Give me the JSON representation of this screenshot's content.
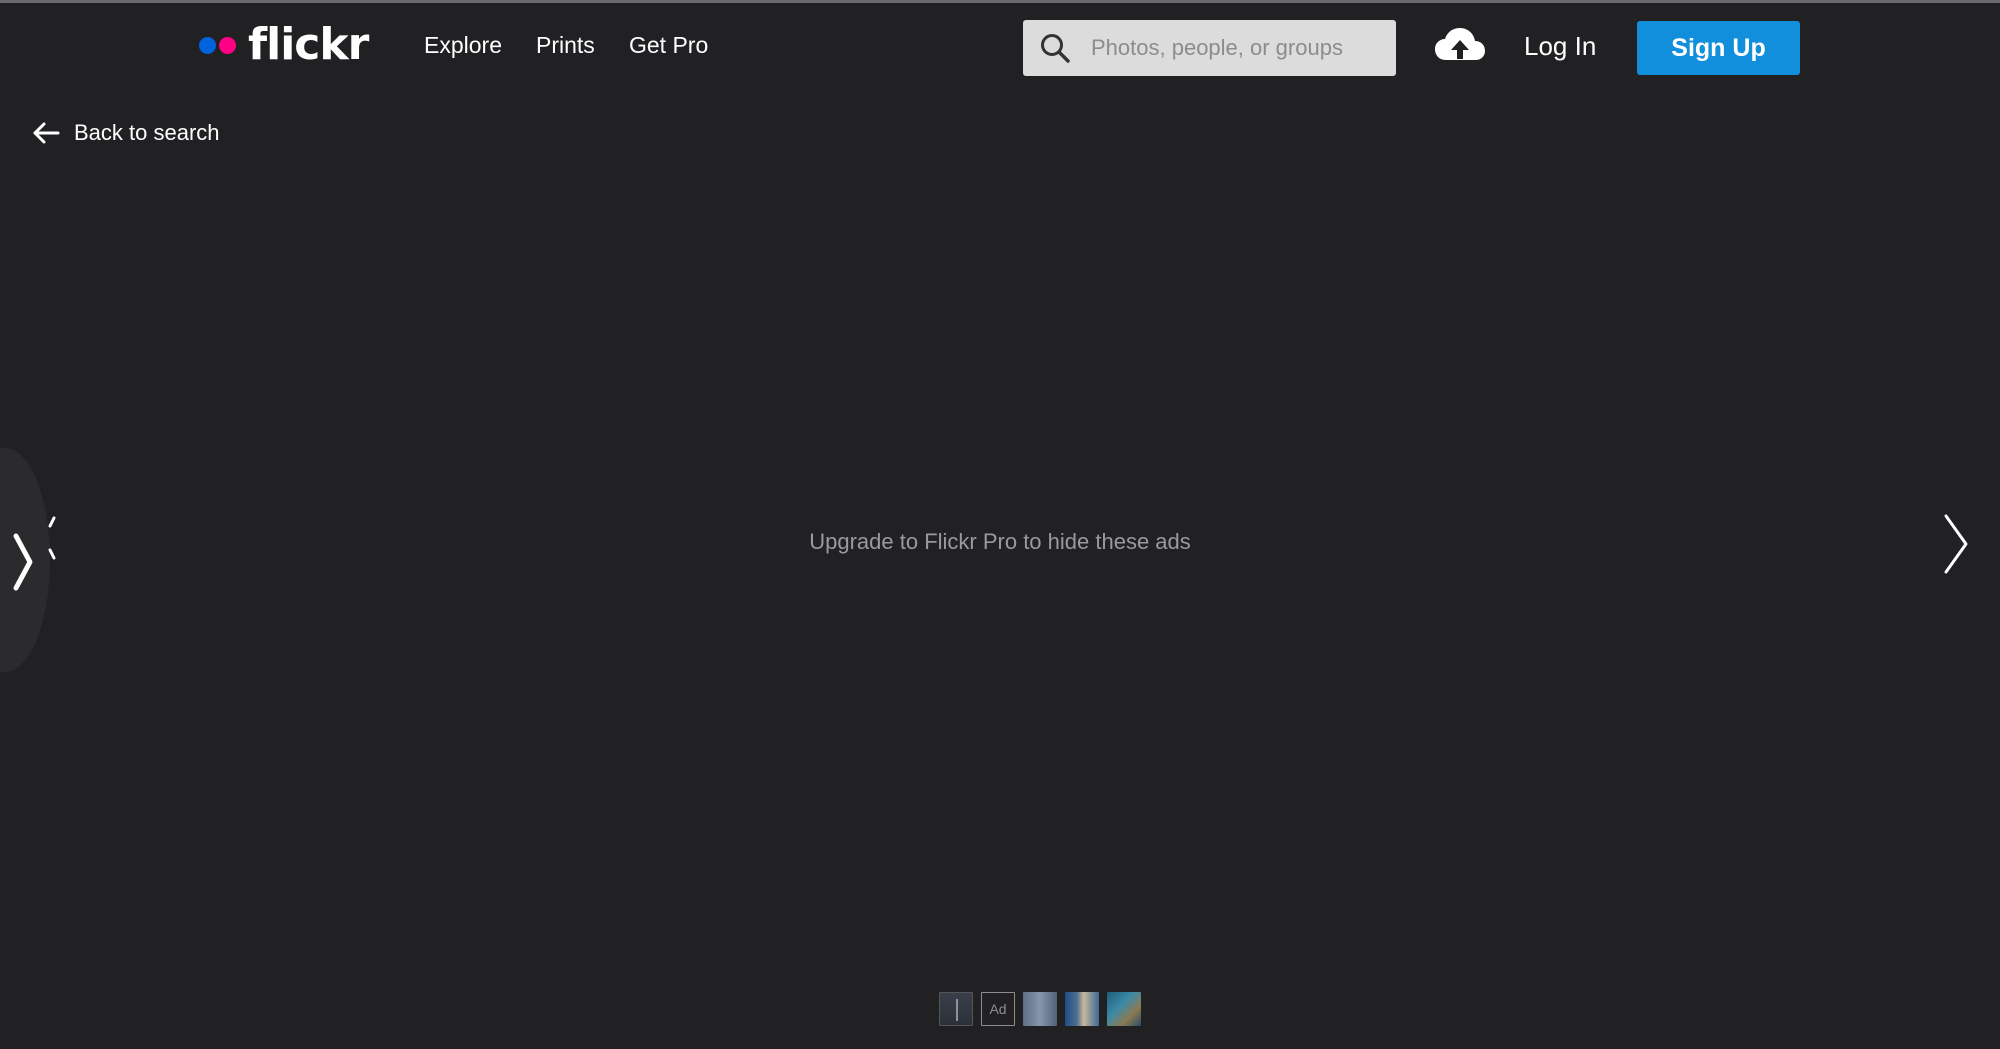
{
  "brand": {
    "name": "flickr",
    "dot_blue": "#0063dc",
    "dot_pink": "#ff0084"
  },
  "nav": {
    "links": [
      "Explore",
      "Prints",
      "Get Pro"
    ]
  },
  "search": {
    "placeholder": "Photos, people, or groups",
    "value": ""
  },
  "header": {
    "login_label": "Log In",
    "signup_label": "Sign Up",
    "signup_color": "#128fdc",
    "upload_icon": "cloud-upload-icon"
  },
  "back": {
    "label": "Back to search",
    "icon": "arrow-left-icon"
  },
  "main": {
    "ad_message": "Upgrade to Flickr Pro to hide these ads"
  },
  "filmstrip": {
    "items": [
      {
        "kind": "photo"
      },
      {
        "kind": "ad",
        "label": "Ad"
      },
      {
        "kind": "photo"
      },
      {
        "kind": "photo"
      },
      {
        "kind": "photo"
      }
    ]
  }
}
